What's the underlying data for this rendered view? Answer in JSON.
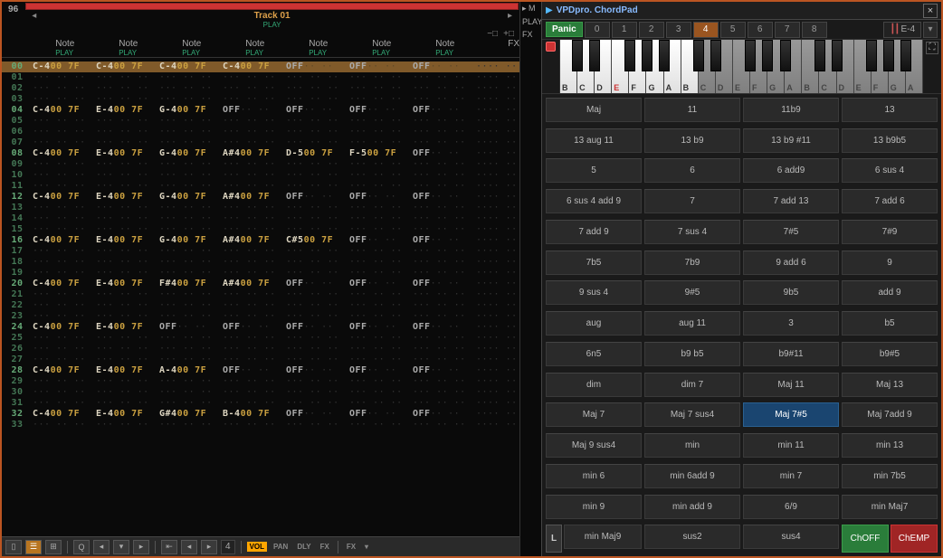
{
  "editor": {
    "row_counter": "96",
    "track_title": "Track 01",
    "play": "PLAY",
    "arrow_left": "◂",
    "arrow_right": "▸",
    "minus": "−□",
    "plus": "+□",
    "note_label": "Note",
    "fx_label": "FX",
    "mid_M": "M",
    "mid_PLAY": "PLAY",
    "mid_FX": "FX",
    "rows": [
      {
        "n": "00",
        "hi": 1,
        "sel": 1,
        "c": [
          [
            "C-4",
            "00",
            "7F"
          ],
          [
            "C-4",
            "00",
            "7F"
          ],
          [
            "C-4",
            "00",
            "7F"
          ],
          [
            "C-4",
            "00",
            "7F"
          ],
          [
            "OFF",
            "",
            ""
          ],
          [
            "OFF",
            "",
            ""
          ],
          [
            "OFF",
            "",
            ""
          ]
        ]
      },
      {
        "n": "01"
      },
      {
        "n": "02"
      },
      {
        "n": "03"
      },
      {
        "n": "04",
        "hi": 1,
        "c": [
          [
            "C-4",
            "00",
            "7F"
          ],
          [
            "E-4",
            "00",
            "7F"
          ],
          [
            "G-4",
            "00",
            "7F"
          ],
          [
            "OFF",
            "",
            ""
          ],
          [
            "OFF",
            "",
            ""
          ],
          [
            "OFF",
            "",
            ""
          ],
          [
            "OFF",
            "",
            ""
          ]
        ]
      },
      {
        "n": "05"
      },
      {
        "n": "06"
      },
      {
        "n": "07"
      },
      {
        "n": "08",
        "hi": 1,
        "c": [
          [
            "C-4",
            "00",
            "7F"
          ],
          [
            "E-4",
            "00",
            "7F"
          ],
          [
            "G-4",
            "00",
            "7F"
          ],
          [
            "A#4",
            "00",
            "7F"
          ],
          [
            "D-5",
            "00",
            "7F"
          ],
          [
            "F-5",
            "00",
            "7F"
          ],
          [
            "OFF",
            "",
            ""
          ]
        ]
      },
      {
        "n": "09"
      },
      {
        "n": "10"
      },
      {
        "n": "11"
      },
      {
        "n": "12",
        "hi": 1,
        "c": [
          [
            "C-4",
            "00",
            "7F"
          ],
          [
            "E-4",
            "00",
            "7F"
          ],
          [
            "G-4",
            "00",
            "7F"
          ],
          [
            "A#4",
            "00",
            "7F"
          ],
          [
            "OFF",
            "",
            ""
          ],
          [
            "OFF",
            "",
            ""
          ],
          [
            "OFF",
            "",
            ""
          ]
        ]
      },
      {
        "n": "13"
      },
      {
        "n": "14"
      },
      {
        "n": "15"
      },
      {
        "n": "16",
        "hi": 1,
        "c": [
          [
            "C-4",
            "00",
            "7F"
          ],
          [
            "E-4",
            "00",
            "7F"
          ],
          [
            "G-4",
            "00",
            "7F"
          ],
          [
            "A#4",
            "00",
            "7F"
          ],
          [
            "C#5",
            "00",
            "7F"
          ],
          [
            "OFF",
            "",
            ""
          ],
          [
            "OFF",
            "",
            ""
          ]
        ]
      },
      {
        "n": "17"
      },
      {
        "n": "18"
      },
      {
        "n": "19"
      },
      {
        "n": "20",
        "hi": 1,
        "c": [
          [
            "C-4",
            "00",
            "7F"
          ],
          [
            "E-4",
            "00",
            "7F"
          ],
          [
            "F#4",
            "00",
            "7F"
          ],
          [
            "A#4",
            "00",
            "7F"
          ],
          [
            "OFF",
            "",
            ""
          ],
          [
            "OFF",
            "",
            ""
          ],
          [
            "OFF",
            "",
            ""
          ]
        ]
      },
      {
        "n": "21"
      },
      {
        "n": "22"
      },
      {
        "n": "23"
      },
      {
        "n": "24",
        "hi": 1,
        "c": [
          [
            "C-4",
            "00",
            "7F"
          ],
          [
            "E-4",
            "00",
            "7F"
          ],
          [
            "OFF",
            "",
            ""
          ],
          [
            "OFF",
            "",
            ""
          ],
          [
            "OFF",
            "",
            ""
          ],
          [
            "OFF",
            "",
            ""
          ],
          [
            "OFF",
            "",
            ""
          ]
        ]
      },
      {
        "n": "25"
      },
      {
        "n": "26"
      },
      {
        "n": "27"
      },
      {
        "n": "28",
        "hi": 1,
        "c": [
          [
            "C-4",
            "00",
            "7F"
          ],
          [
            "E-4",
            "00",
            "7F"
          ],
          [
            "A-4",
            "00",
            "7F"
          ],
          [
            "OFF",
            "",
            ""
          ],
          [
            "OFF",
            "",
            ""
          ],
          [
            "OFF",
            "",
            ""
          ],
          [
            "OFF",
            "",
            ""
          ]
        ]
      },
      {
        "n": "29"
      },
      {
        "n": "30"
      },
      {
        "n": "31"
      },
      {
        "n": "32",
        "hi": 1,
        "c": [
          [
            "C-4",
            "00",
            "7F"
          ],
          [
            "E-4",
            "00",
            "7F"
          ],
          [
            "G#4",
            "00",
            "7F"
          ],
          [
            "B-4",
            "00",
            "7F"
          ],
          [
            "OFF",
            "",
            ""
          ],
          [
            "OFF",
            "",
            ""
          ],
          [
            "OFF",
            "",
            ""
          ]
        ]
      },
      {
        "n": "33"
      }
    ],
    "bottom": {
      "Q": "Q",
      "step": "4",
      "arrows": "◂▸",
      "vol": "VOL",
      "pan": "PAN",
      "dly": "DLY",
      "fx": "FX",
      "fx2": "FX"
    }
  },
  "chordpad": {
    "title": "VPDpro. ChordPad",
    "close": "×",
    "panic": "Panic",
    "nums": [
      "0",
      "1",
      "2",
      "3",
      "4",
      "5",
      "6",
      "7",
      "8"
    ],
    "active_num": 4,
    "root": "E-4",
    "dd": "▾",
    "key_labels": [
      "B",
      "C",
      "D",
      "E",
      "F",
      "G",
      "A",
      "B",
      "C",
      "D",
      "E",
      "F",
      "G",
      "A",
      "B",
      "C",
      "D",
      "E",
      "F",
      "G",
      "A"
    ],
    "root_index": 3,
    "dim_from": 8,
    "chords": [
      "Maj",
      "11",
      "11b9",
      "13",
      "13 aug 11",
      "13 b9",
      "13 b9 #11",
      "13 b9b5",
      "5",
      "6",
      "6 add9",
      "6 sus 4",
      "6 sus 4 add 9",
      "7",
      "7 add 13",
      "7 add 6",
      "7 add 9",
      "7 sus 4",
      "7#5",
      "7#9",
      "7b5",
      "7b9",
      "9 add 6",
      "9",
      "9 sus 4",
      "9#5",
      "9b5",
      "add 9",
      "aug",
      "aug 11",
      "3",
      "b5",
      "6n5",
      "b9 b5",
      "b9#11",
      "b9#5",
      "dim",
      "dim 7",
      "Maj 11",
      "Maj 13",
      "Maj 7",
      "Maj 7 sus4",
      "Maj 7#5",
      "Maj 7add 9",
      "Maj 9 sus4",
      "min",
      "min 11",
      "min 13",
      "min 6",
      "min 6add 9",
      "min 7",
      "min 7b5",
      "min 9",
      "min add 9",
      "6/9",
      "min Maj7"
    ],
    "active_chord": 42,
    "L": "L",
    "last_row": [
      "min Maj9",
      "sus2",
      "sus4"
    ],
    "choff": "ChOFF",
    "chemp": "ChEMP"
  }
}
